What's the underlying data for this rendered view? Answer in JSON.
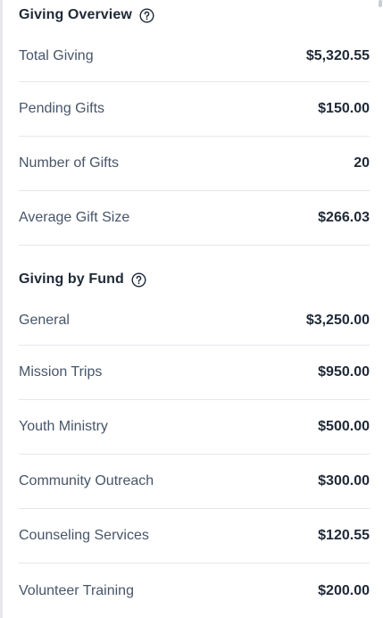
{
  "overview": {
    "title": "Giving Overview",
    "rows": [
      {
        "label": "Total Giving",
        "value": "$5,320.55"
      },
      {
        "label": "Pending Gifts",
        "value": "$150.00"
      },
      {
        "label": "Number of Gifts",
        "value": "20"
      },
      {
        "label": "Average Gift Size",
        "value": "$266.03"
      }
    ]
  },
  "funds": {
    "title": "Giving by Fund",
    "rows": [
      {
        "label": "General",
        "value": "$3,250.00"
      },
      {
        "label": "Mission Trips",
        "value": "$950.00"
      },
      {
        "label": "Youth Ministry",
        "value": "$500.00"
      },
      {
        "label": "Community Outreach",
        "value": "$300.00"
      },
      {
        "label": "Counseling Services",
        "value": "$120.55"
      },
      {
        "label": "Volunteer Training",
        "value": "$200.00"
      }
    ]
  },
  "icons": {
    "help": "question-circle-icon"
  }
}
